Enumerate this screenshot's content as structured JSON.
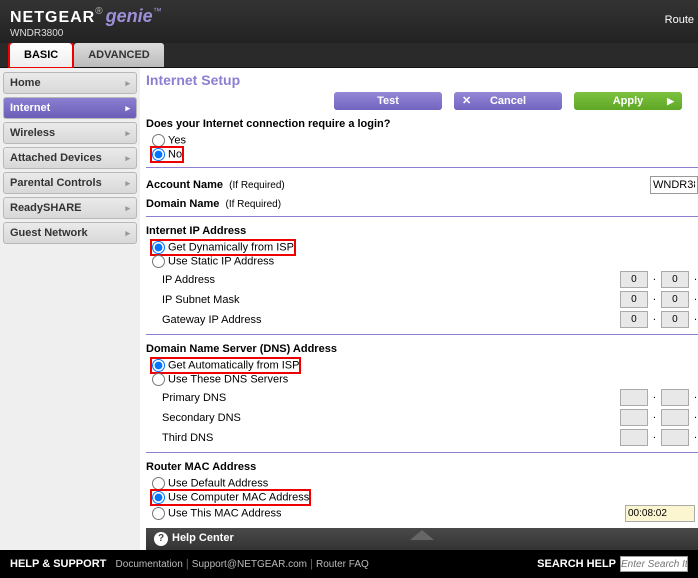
{
  "brand": {
    "logo": "NETGEAR",
    "genie": "genie",
    "model": "WNDR3800"
  },
  "header_right": "Route",
  "tabs": {
    "basic": "BASIC",
    "advanced": "ADVANCED"
  },
  "sidebar": {
    "items": [
      {
        "label": "Home"
      },
      {
        "label": "Internet"
      },
      {
        "label": "Wireless"
      },
      {
        "label": "Attached Devices"
      },
      {
        "label": "Parental Controls"
      },
      {
        "label": "ReadySHARE"
      },
      {
        "label": "Guest Network"
      }
    ]
  },
  "page": {
    "title": "Internet Setup"
  },
  "buttons": {
    "test": "Test",
    "cancel": "Cancel",
    "apply": "Apply"
  },
  "login_q": {
    "label": "Does your Internet connection require a login?",
    "yes": "Yes",
    "no": "No"
  },
  "account": {
    "name_label": "Account Name",
    "hint": "(If Required)",
    "value": "WNDR38",
    "domain_label": "Domain Name"
  },
  "ip": {
    "title": "Internet IP Address",
    "dynamic": "Get Dynamically from ISP",
    "static": "Use Static IP Address",
    "ip_addr": "IP Address",
    "subnet": "IP Subnet Mask",
    "gateway": "Gateway IP Address",
    "zero": "0"
  },
  "dns": {
    "title": "Domain Name Server (DNS) Address",
    "auto": "Get Automatically from ISP",
    "use": "Use These DNS Servers",
    "primary": "Primary DNS",
    "secondary": "Secondary DNS",
    "third": "Third DNS"
  },
  "mac": {
    "title": "Router MAC Address",
    "default": "Use Default Address",
    "computer": "Use Computer MAC Address",
    "this": "Use This MAC Address",
    "value": "00:08:02"
  },
  "help": {
    "center": "Help Center"
  },
  "footer": {
    "help_support": "HELP & SUPPORT",
    "doc": "Documentation",
    "support": "Support@NETGEAR.com",
    "faq": "Router FAQ",
    "search": "SEARCH HELP",
    "placeholder": "Enter Search It"
  }
}
